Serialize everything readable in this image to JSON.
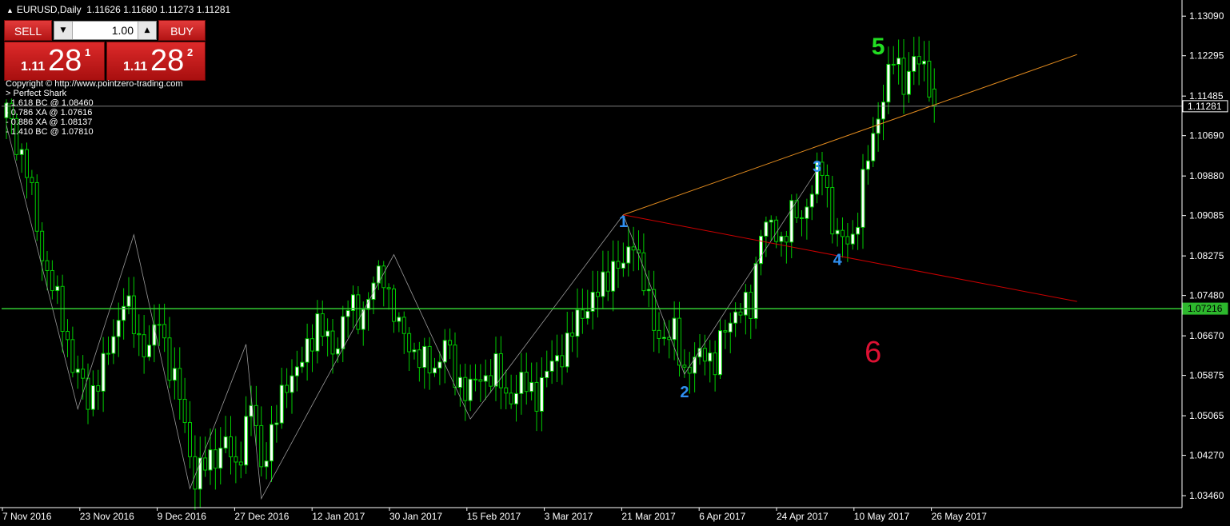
{
  "header": {
    "symbol": "EURUSD,Daily",
    "ohlc": "1.11626 1.11680 1.11273 1.11281"
  },
  "trade_panel": {
    "sell_label": "SELL",
    "buy_label": "BUY",
    "lot_size": "1.00",
    "sell_price": {
      "prefix": "1.11",
      "big": "28",
      "sup": "1"
    },
    "buy_price": {
      "prefix": "1.11",
      "big": "28",
      "sup": "2"
    }
  },
  "indicator_text": [
    "Copyright © http://www.pointzero-trading.com",
    "> Perfect Shark",
    "- 1.618 BC @ 1.08460",
    "- 0.786 XA @ 1.07616",
    "- 0.886 XA @ 1.08137",
    "- 1.410 BC @ 1.07810"
  ],
  "colors": {
    "background": "#000000",
    "bull_candle": "#ffffff",
    "bear_candle": "#000000",
    "wick": "#00cc00",
    "green_level": "#33cc33",
    "red_line": "#cc0000",
    "orange_line": "#e08a1e",
    "wave_label_blue": "#2f8ff0",
    "wave_label_green": "#22dd22",
    "wave_label_red": "#dd1133"
  },
  "chart_data": {
    "type": "candlestick",
    "symbol": "EURUSD",
    "timeframe": "Daily",
    "last_price": 1.11281,
    "ylim": [
      1.0322,
      1.1335
    ],
    "y_ticks": [
      1.1309,
      1.12295,
      1.11485,
      1.1069,
      1.0988,
      1.09085,
      1.08275,
      1.0748,
      1.0667,
      1.05875,
      1.05065,
      1.0427,
      1.0346
    ],
    "y_tick_labels": [
      "1.13090",
      "1.12295",
      "1.11485",
      "1.10690",
      "1.09880",
      "1.09085",
      "1.08275",
      "1.07480",
      "1.06670",
      "1.05875",
      "1.05065",
      "1.04270",
      "1.03460"
    ],
    "x_tick_labels": [
      "7 Nov 2016",
      "23 Nov 2016",
      "9 Dec 2016",
      "27 Dec 2016",
      "12 Jan 2017",
      "30 Jan 2017",
      "15 Feb 2017",
      "3 Mar 2017",
      "21 Mar 2017",
      "6 Apr 2017",
      "24 Apr 2017",
      "10 May 2017",
      "26 May 2017"
    ],
    "price_markers": [
      {
        "label": "1.11281",
        "value": 1.11281,
        "style": "white"
      },
      {
        "label": "1.07216",
        "value": 1.07216,
        "style": "green"
      }
    ],
    "anchors": [
      {
        "i": 0,
        "p": 1.112
      },
      {
        "i": 4,
        "p": 1.1
      },
      {
        "i": 7,
        "p": 1.083
      },
      {
        "i": 11,
        "p": 1.07
      },
      {
        "i": 13,
        "p": 1.061
      },
      {
        "i": 16,
        "p": 1.054
      },
      {
        "i": 19,
        "p": 1.06
      },
      {
        "i": 23,
        "p": 1.074
      },
      {
        "i": 26,
        "p": 1.066
      },
      {
        "i": 28,
        "p": 1.064
      },
      {
        "i": 30,
        "p": 1.07
      },
      {
        "i": 32,
        "p": 1.061
      },
      {
        "i": 34,
        "p": 1.054
      },
      {
        "i": 37,
        "p": 1.038
      },
      {
        "i": 40,
        "p": 1.042
      },
      {
        "i": 43,
        "p": 1.045
      },
      {
        "i": 45,
        "p": 1.04
      },
      {
        "i": 48,
        "p": 1.053
      },
      {
        "i": 50,
        "p": 1.041
      },
      {
        "i": 53,
        "p": 1.05
      },
      {
        "i": 55,
        "p": 1.058
      },
      {
        "i": 58,
        "p": 1.061
      },
      {
        "i": 61,
        "p": 1.07
      },
      {
        "i": 64,
        "p": 1.063
      },
      {
        "i": 67,
        "p": 1.073
      },
      {
        "i": 69,
        "p": 1.07
      },
      {
        "i": 72,
        "p": 1.077
      },
      {
        "i": 74,
        "p": 1.079
      },
      {
        "i": 77,
        "p": 1.068
      },
      {
        "i": 79,
        "p": 1.065
      },
      {
        "i": 82,
        "p": 1.061
      },
      {
        "i": 84,
        "p": 1.06
      },
      {
        "i": 86,
        "p": 1.066
      },
      {
        "i": 88,
        "p": 1.058
      },
      {
        "i": 91,
        "p": 1.056
      },
      {
        "i": 93,
        "p": 1.058
      },
      {
        "i": 96,
        "p": 1.06
      },
      {
        "i": 98,
        "p": 1.054
      },
      {
        "i": 101,
        "p": 1.057
      },
      {
        "i": 104,
        "p": 1.055
      },
      {
        "i": 107,
        "p": 1.061
      },
      {
        "i": 110,
        "p": 1.065
      },
      {
        "i": 113,
        "p": 1.072
      },
      {
        "i": 116,
        "p": 1.075
      },
      {
        "i": 119,
        "p": 1.081
      },
      {
        "i": 121,
        "p": 1.08
      },
      {
        "i": 123,
        "p": 1.087
      },
      {
        "i": 125,
        "p": 1.077
      },
      {
        "i": 127,
        "p": 1.069
      },
      {
        "i": 129,
        "p": 1.066
      },
      {
        "i": 131,
        "p": 1.067
      },
      {
        "i": 133,
        "p": 1.06
      },
      {
        "i": 135,
        "p": 1.061
      },
      {
        "i": 137,
        "p": 1.064
      },
      {
        "i": 139,
        "p": 1.061
      },
      {
        "i": 141,
        "p": 1.068
      },
      {
        "i": 143,
        "p": 1.072
      },
      {
        "i": 146,
        "p": 1.072
      },
      {
        "i": 148,
        "p": 1.089
      },
      {
        "i": 150,
        "p": 1.088
      },
      {
        "i": 152,
        "p": 1.086
      },
      {
        "i": 154,
        "p": 1.091
      },
      {
        "i": 156,
        "p": 1.09
      },
      {
        "i": 158,
        "p": 1.097
      },
      {
        "i": 160,
        "p": 1.1
      },
      {
        "i": 162,
        "p": 1.09
      },
      {
        "i": 164,
        "p": 1.085
      },
      {
        "i": 166,
        "p": 1.086
      },
      {
        "i": 168,
        "p": 1.098
      },
      {
        "i": 170,
        "p": 1.106
      },
      {
        "i": 172,
        "p": 1.116
      },
      {
        "i": 174,
        "p": 1.122
      },
      {
        "i": 176,
        "p": 1.118
      },
      {
        "i": 178,
        "p": 1.122
      },
      {
        "i": 180,
        "p": 1.12
      },
      {
        "i": 182,
        "p": 1.1163
      }
    ],
    "zigzag": [
      {
        "i": 0,
        "p": 1.109
      },
      {
        "i": 14,
        "p": 1.052
      },
      {
        "i": 25,
        "p": 1.087
      },
      {
        "i": 36,
        "p": 1.036
      },
      {
        "i": 47,
        "p": 1.065
      },
      {
        "i": 50,
        "p": 1.034
      },
      {
        "i": 76,
        "p": 1.083
      },
      {
        "i": 91,
        "p": 1.05
      },
      {
        "i": 121,
        "p": 1.091
      },
      {
        "i": 133,
        "p": 1.059
      },
      {
        "i": 159,
        "p": 1.1
      }
    ],
    "pattern_lines": [
      {
        "from": {
          "i": 121,
          "p": 1.091
        },
        "to": {
          "i": 210,
          "p": 1.1232
        },
        "color": "orange"
      },
      {
        "from": {
          "i": 121,
          "p": 1.091
        },
        "to": {
          "i": 210,
          "p": 1.0736
        },
        "color": "red"
      }
    ],
    "wave_labels": [
      {
        "text": "1",
        "i": 121,
        "p": 1.0894,
        "color": "blue"
      },
      {
        "text": "2",
        "i": 133,
        "p": 1.0552,
        "color": "blue"
      },
      {
        "text": "3",
        "i": 159,
        "p": 1.1005,
        "color": "blue"
      },
      {
        "text": "4",
        "i": 163,
        "p": 1.0818,
        "color": "blue"
      },
      {
        "text": "5",
        "i": 171,
        "p": 1.1245,
        "color": "green"
      },
      {
        "text": "6",
        "i": 170,
        "p": 1.063,
        "color": "red"
      }
    ]
  }
}
